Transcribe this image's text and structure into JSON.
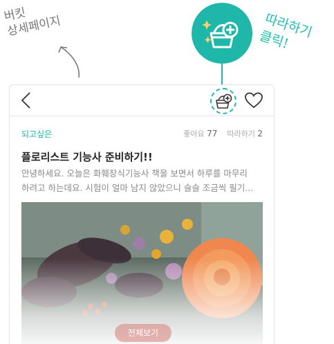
{
  "annotations": {
    "left_note_lines": [
      "버킷",
      "상세페이지"
    ],
    "right_note_lines": [
      "따라하기",
      "클릭!"
    ]
  },
  "colors": {
    "accent": "#1fb7aa",
    "category": "#21b5a8"
  },
  "icons": {
    "fab": "basket-plus-icon",
    "back": "chevron-left-icon",
    "bucket": "basket-plus-icon",
    "like": "heart-icon"
  },
  "post": {
    "category": "되고싶은",
    "likes_label": "좋아요",
    "likes_count": "77",
    "follow_label": "따라하기",
    "follow_count": "2",
    "title": "플로리스트 기능사 준비하기!!",
    "body_lines": [
      "안녕하세요. 오늘은 화훼장식기능사 책을 보면서 하루를 마무리",
      "하려고 하는데요. 시험이 얼마 남지 않았으니 슬슬 조금씩 필기..."
    ],
    "more_button": "전체보기"
  }
}
